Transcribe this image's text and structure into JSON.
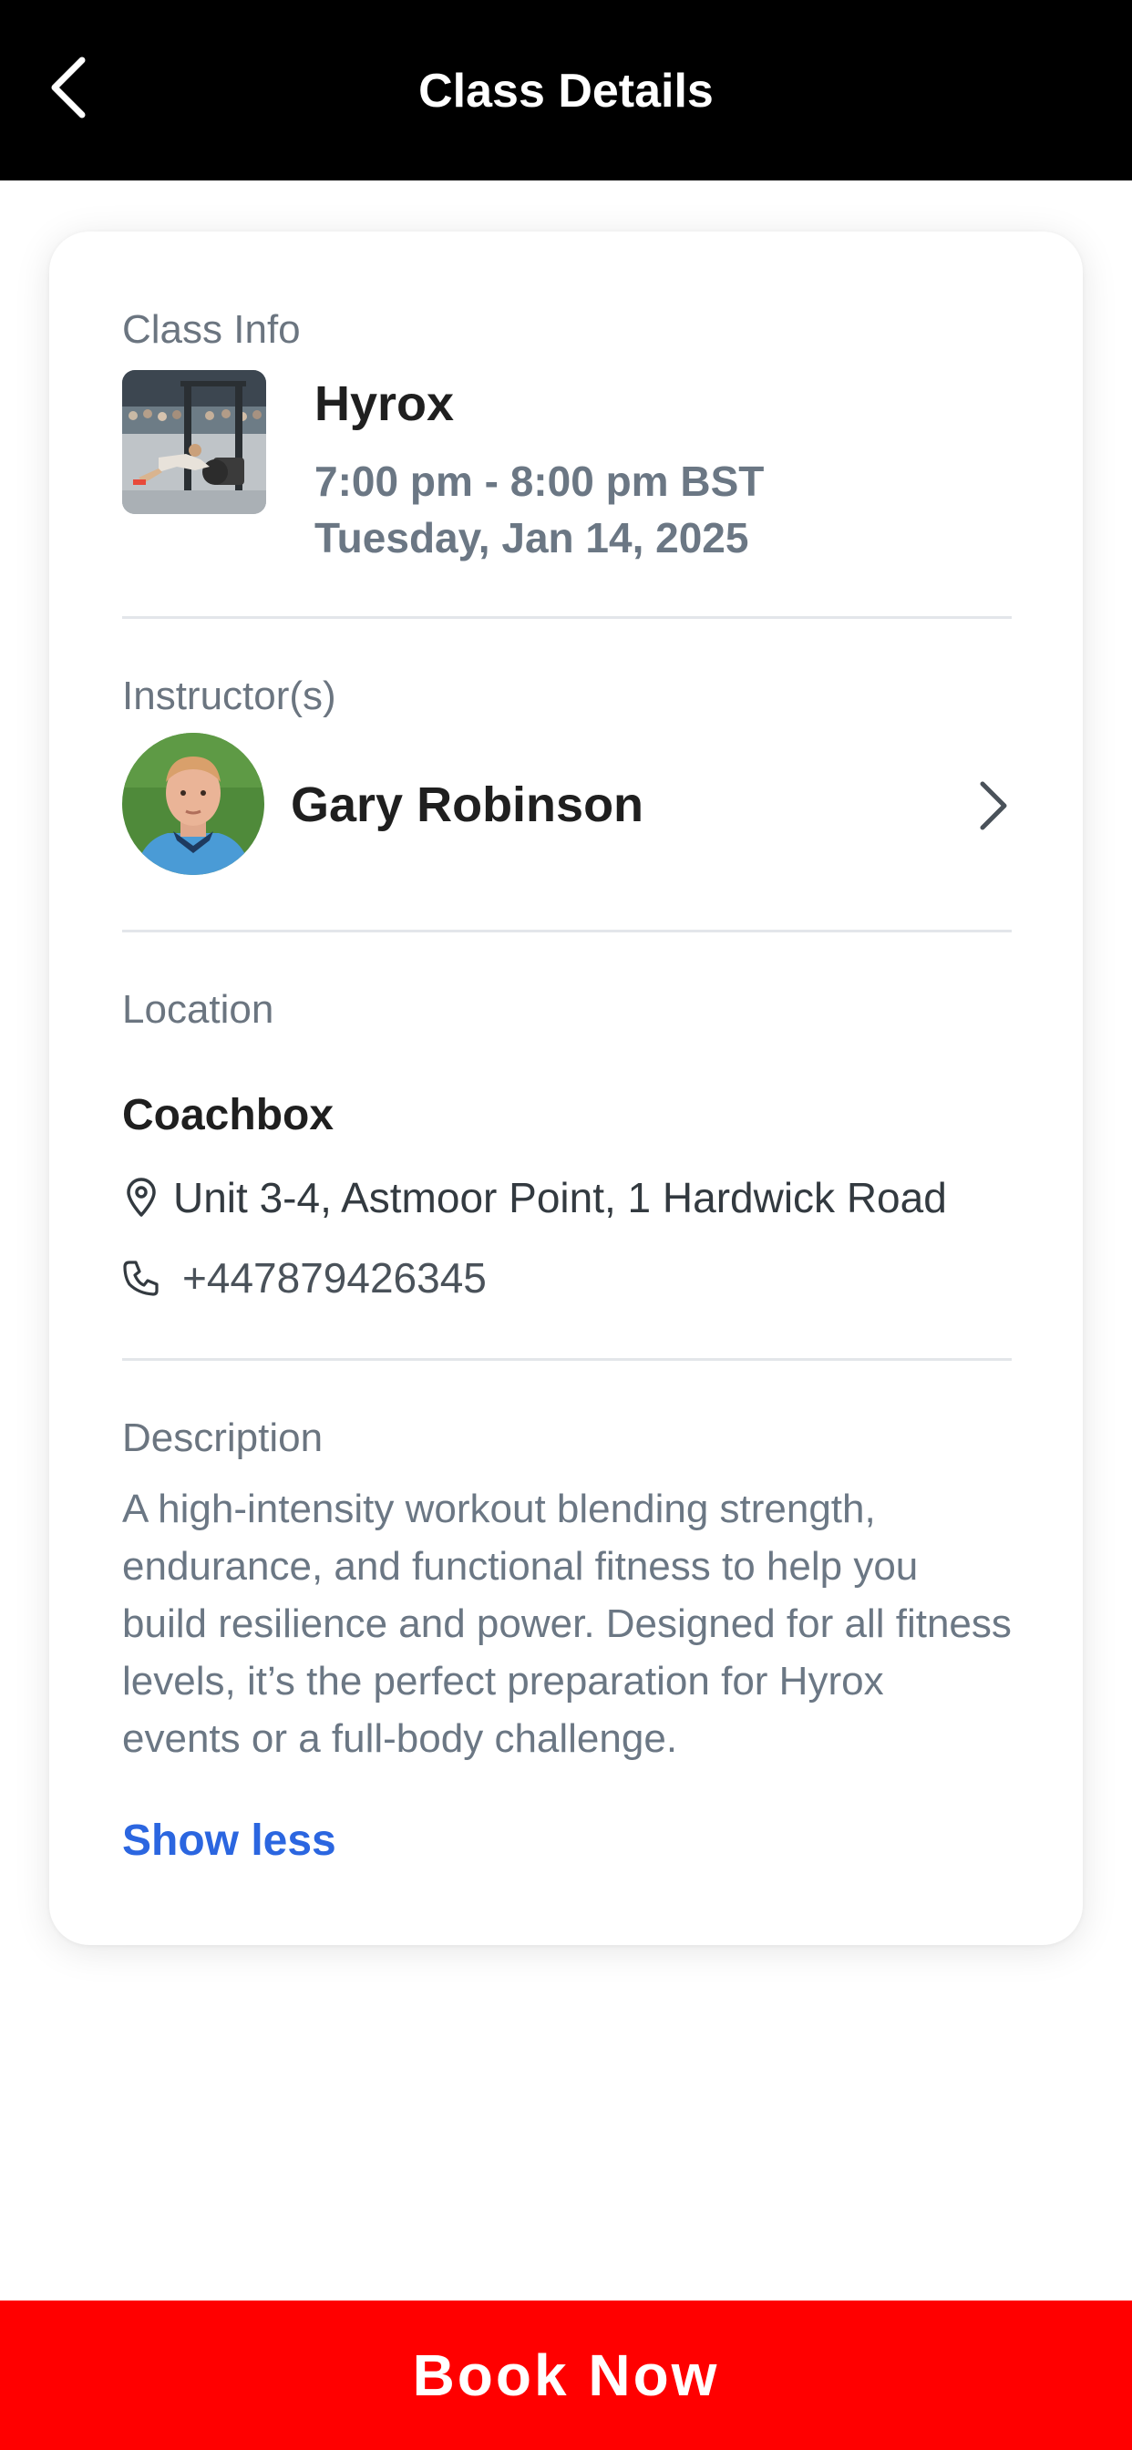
{
  "header": {
    "title": "Class Details",
    "back_icon": "chevron-left-icon"
  },
  "class_info": {
    "label": "Class Info",
    "name": "Hyrox",
    "time": "7:00 pm - 8:00 pm BST",
    "date": "Tuesday, Jan 14, 2025"
  },
  "instructor": {
    "label": "Instructor(s)",
    "name": "Gary Robinson"
  },
  "location": {
    "label": "Location",
    "name": "Coachbox",
    "address": "Unit 3-4, Astmoor Point, 1 Hardwick Road",
    "phone": "+447879426345"
  },
  "description": {
    "label": "Description",
    "text": "A high-intensity workout blending strength, endurance, and functional fitness to help you build resilience and power. Designed for all fitness levels, it’s the perfect preparation for Hyrox events or a full-body challenge.",
    "toggle": "Show less"
  },
  "footer": {
    "book_label": "Book Now"
  },
  "colors": {
    "header_bg": "#000000",
    "accent_red": "#ff0000",
    "link_blue": "#2b66e0",
    "muted_text": "#6b7784"
  }
}
